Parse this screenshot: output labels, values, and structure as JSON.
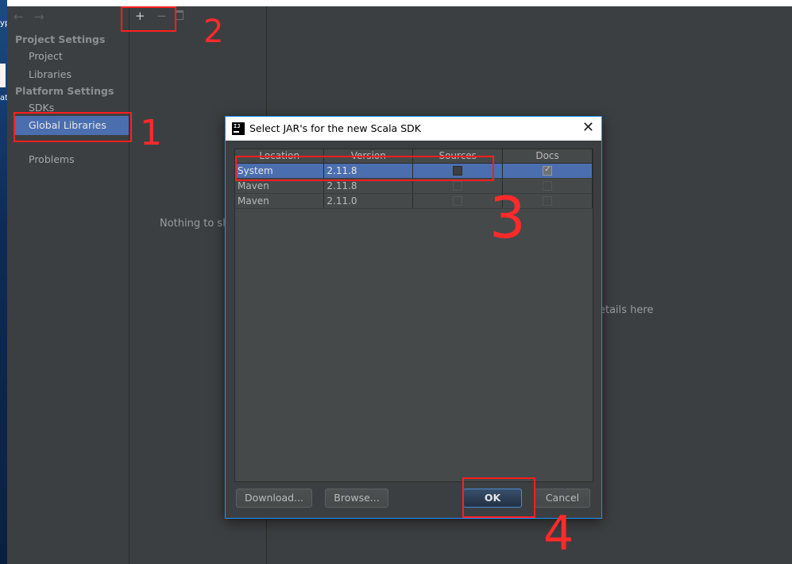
{
  "desktop": {
    "glyph_top": "yp",
    "glyph_bottom": "at"
  },
  "sidebar": {
    "nav": {
      "back": "←",
      "forward": "→"
    },
    "project_settings": {
      "title": "Project Settings",
      "items": [
        "Project",
        "Libraries"
      ]
    },
    "platform_settings": {
      "title": "Platform Settings",
      "items": [
        "SDKs",
        "Global Libraries"
      ]
    },
    "selected": "Global Libraries",
    "problems": "Problems"
  },
  "list_pane": {
    "toolbar": {
      "add": "+",
      "remove": "−",
      "trash_icon": "trash-icon"
    },
    "empty_text": "Nothing to sho"
  },
  "detail_pane": {
    "empty_text": "etails here"
  },
  "dialog": {
    "title": "Select JAR's for the new Scala SDK",
    "icon": "intellij-icon",
    "icon_text": "IJ",
    "close": "✕",
    "columns": [
      "Location",
      "Version",
      "Sources",
      "Docs"
    ],
    "rows": [
      {
        "location": "System",
        "version": "2.11.8",
        "sources": false,
        "docs": true,
        "selected": true
      },
      {
        "location": "Maven",
        "version": "2.11.8",
        "sources": false,
        "docs": false,
        "selected": false
      },
      {
        "location": "Maven",
        "version": "2.11.0",
        "sources": false,
        "docs": false,
        "selected": false
      }
    ],
    "buttons": {
      "download": "Download...",
      "browse": "Browse...",
      "ok": "OK",
      "cancel": "Cancel"
    }
  },
  "annotations": {
    "step1": "1",
    "step2": "2",
    "step3": "3",
    "step4": "4",
    "color": "#ff1f1f"
  }
}
